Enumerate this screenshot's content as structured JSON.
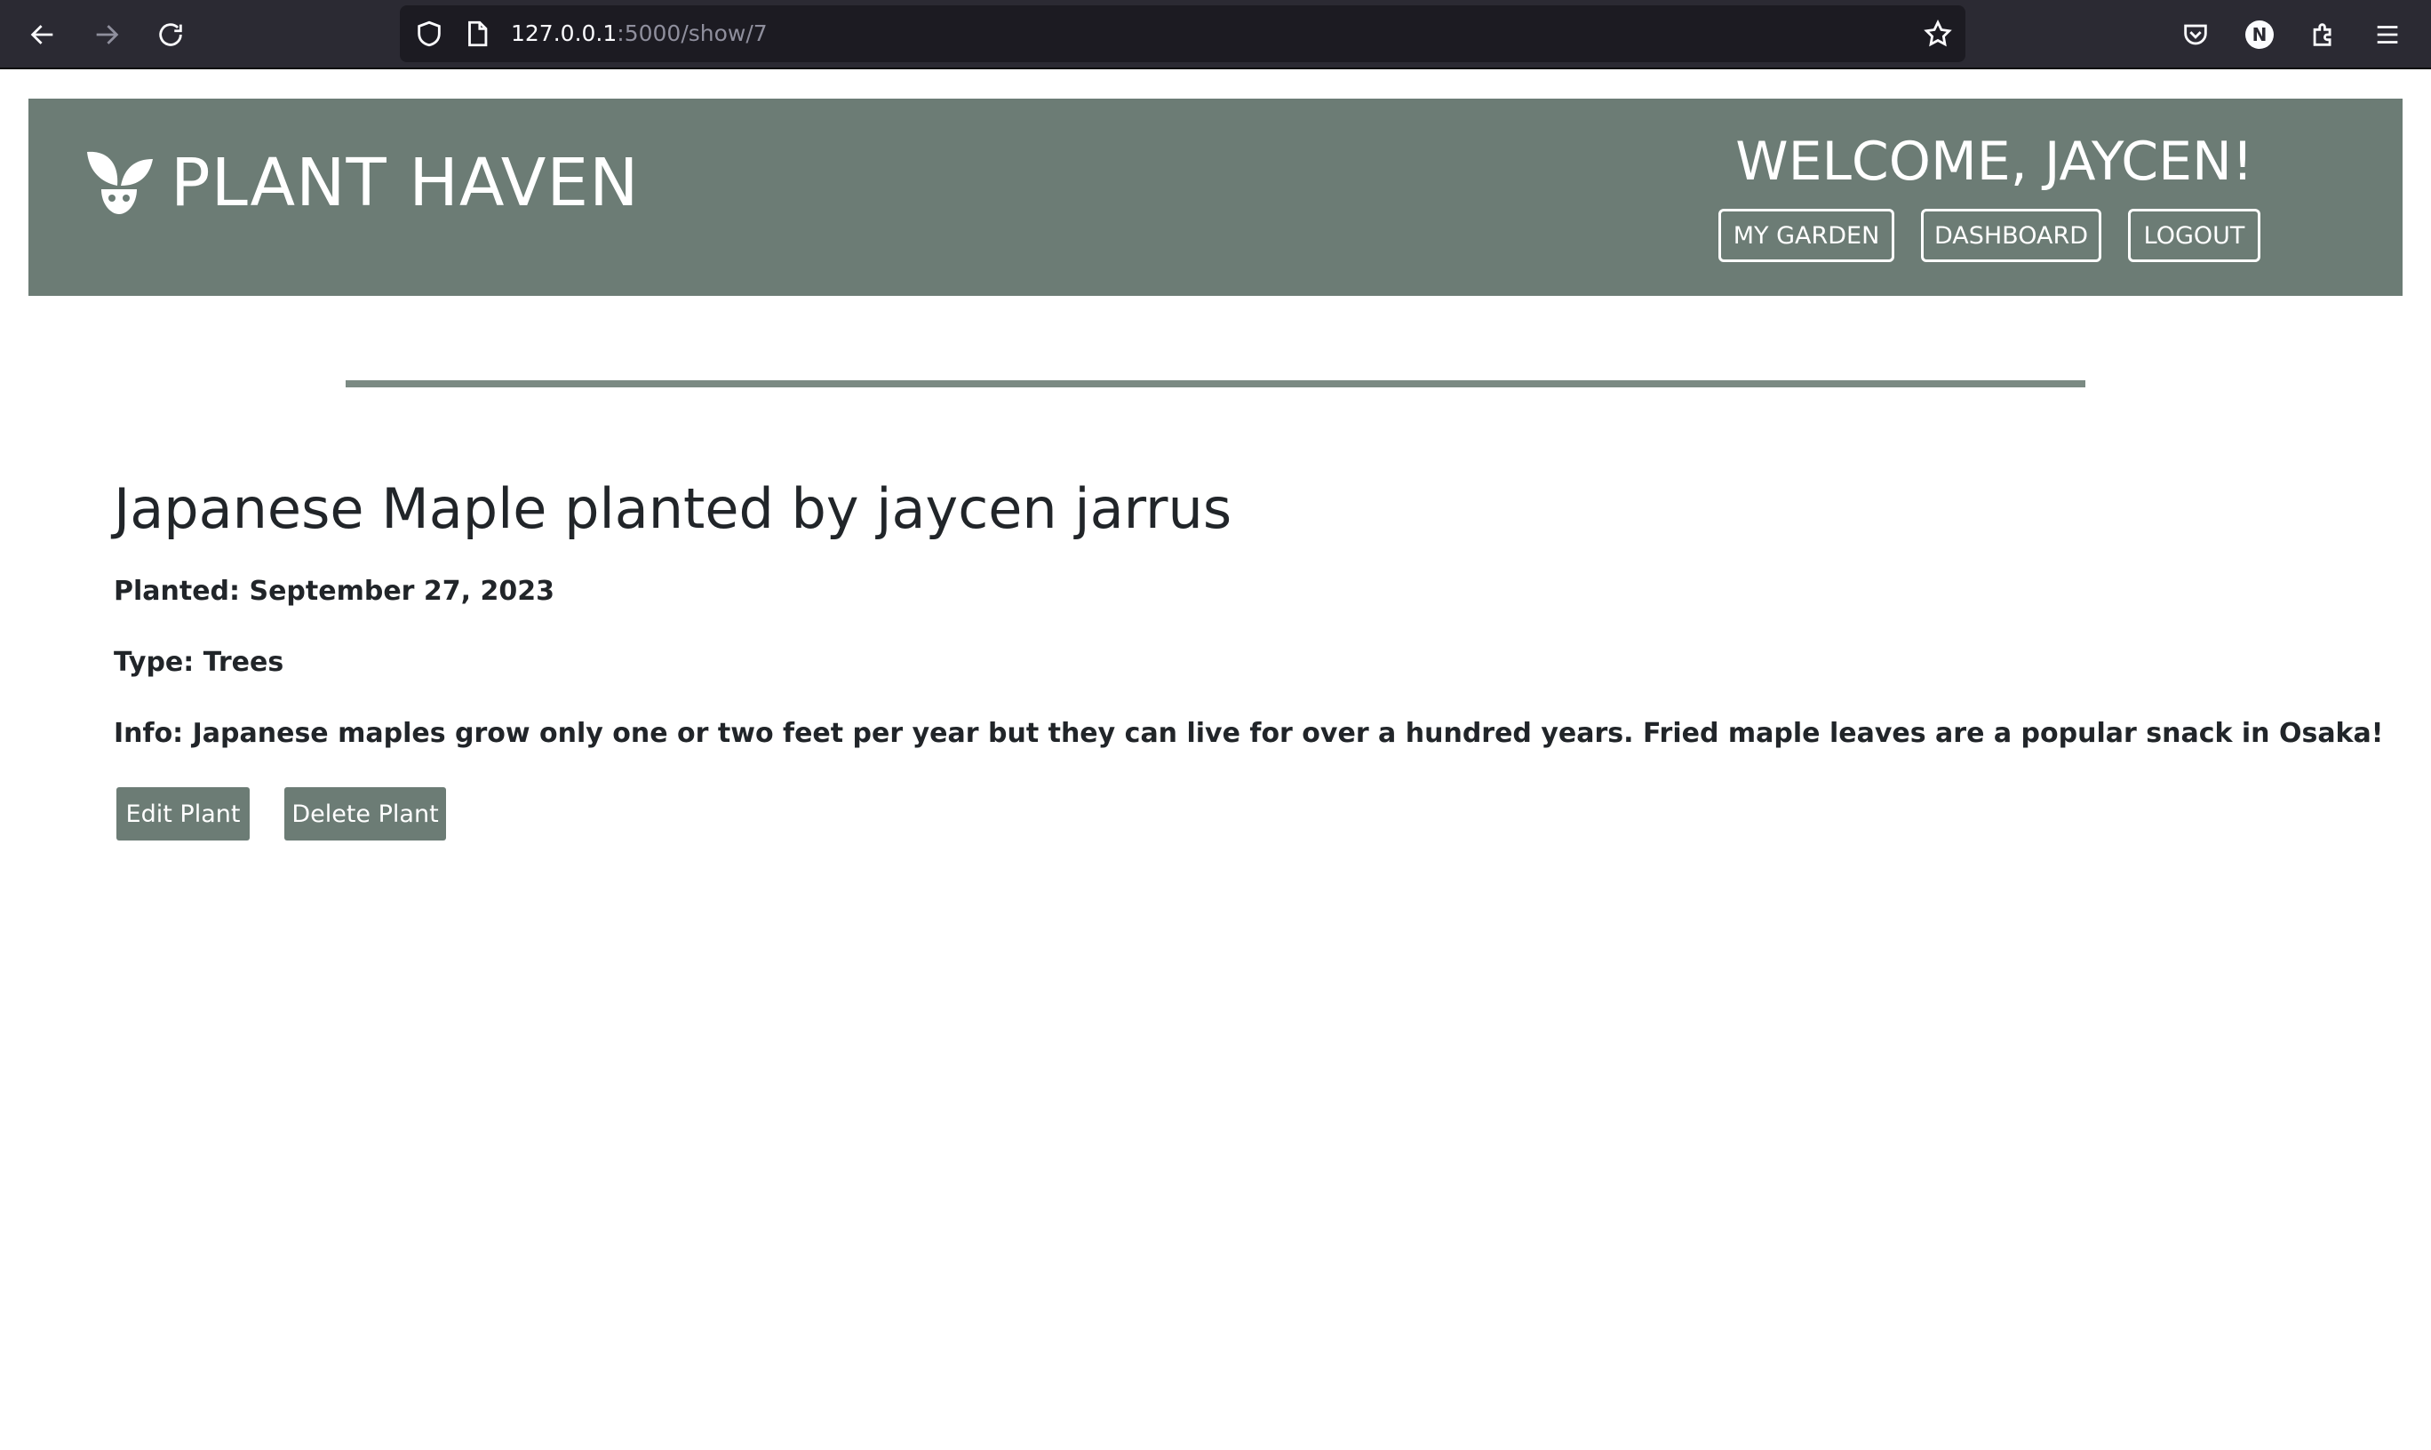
{
  "browser": {
    "url_host": "127.0.0.1",
    "url_path": ":5000/show/7",
    "profile_initial": "N",
    "icons": [
      "back-arrow-icon",
      "forward-arrow-icon",
      "reload-icon",
      "shield-icon",
      "page-icon",
      "star-icon",
      "pocket-icon",
      "extensions-icon",
      "menu-icon"
    ]
  },
  "header": {
    "site_title": "PLANT HAVEN",
    "welcome": "WELCOME, JAYCEN!",
    "nav": {
      "my_garden": "MY GARDEN",
      "dashboard": "DASHBOARD",
      "logout": "LOGOUT"
    }
  },
  "plant": {
    "title": "Japanese Maple planted by jaycen jarrus",
    "planted": "Planted: September 27, 2023",
    "type": "Type: Trees",
    "info": "Info: Japanese maples grow only one or two feet per year but they can live for over a hundred years. Fried maple leaves are a popular snack in Osaka!"
  },
  "actions": {
    "edit": "Edit Plant",
    "delete": "Delete Plant"
  },
  "colors": {
    "header_bg": "#6c7c75",
    "divider": "#7b8a83",
    "button_bg": "#6c7c75",
    "text": "#212529",
    "browser_bg": "#2b2a33"
  }
}
